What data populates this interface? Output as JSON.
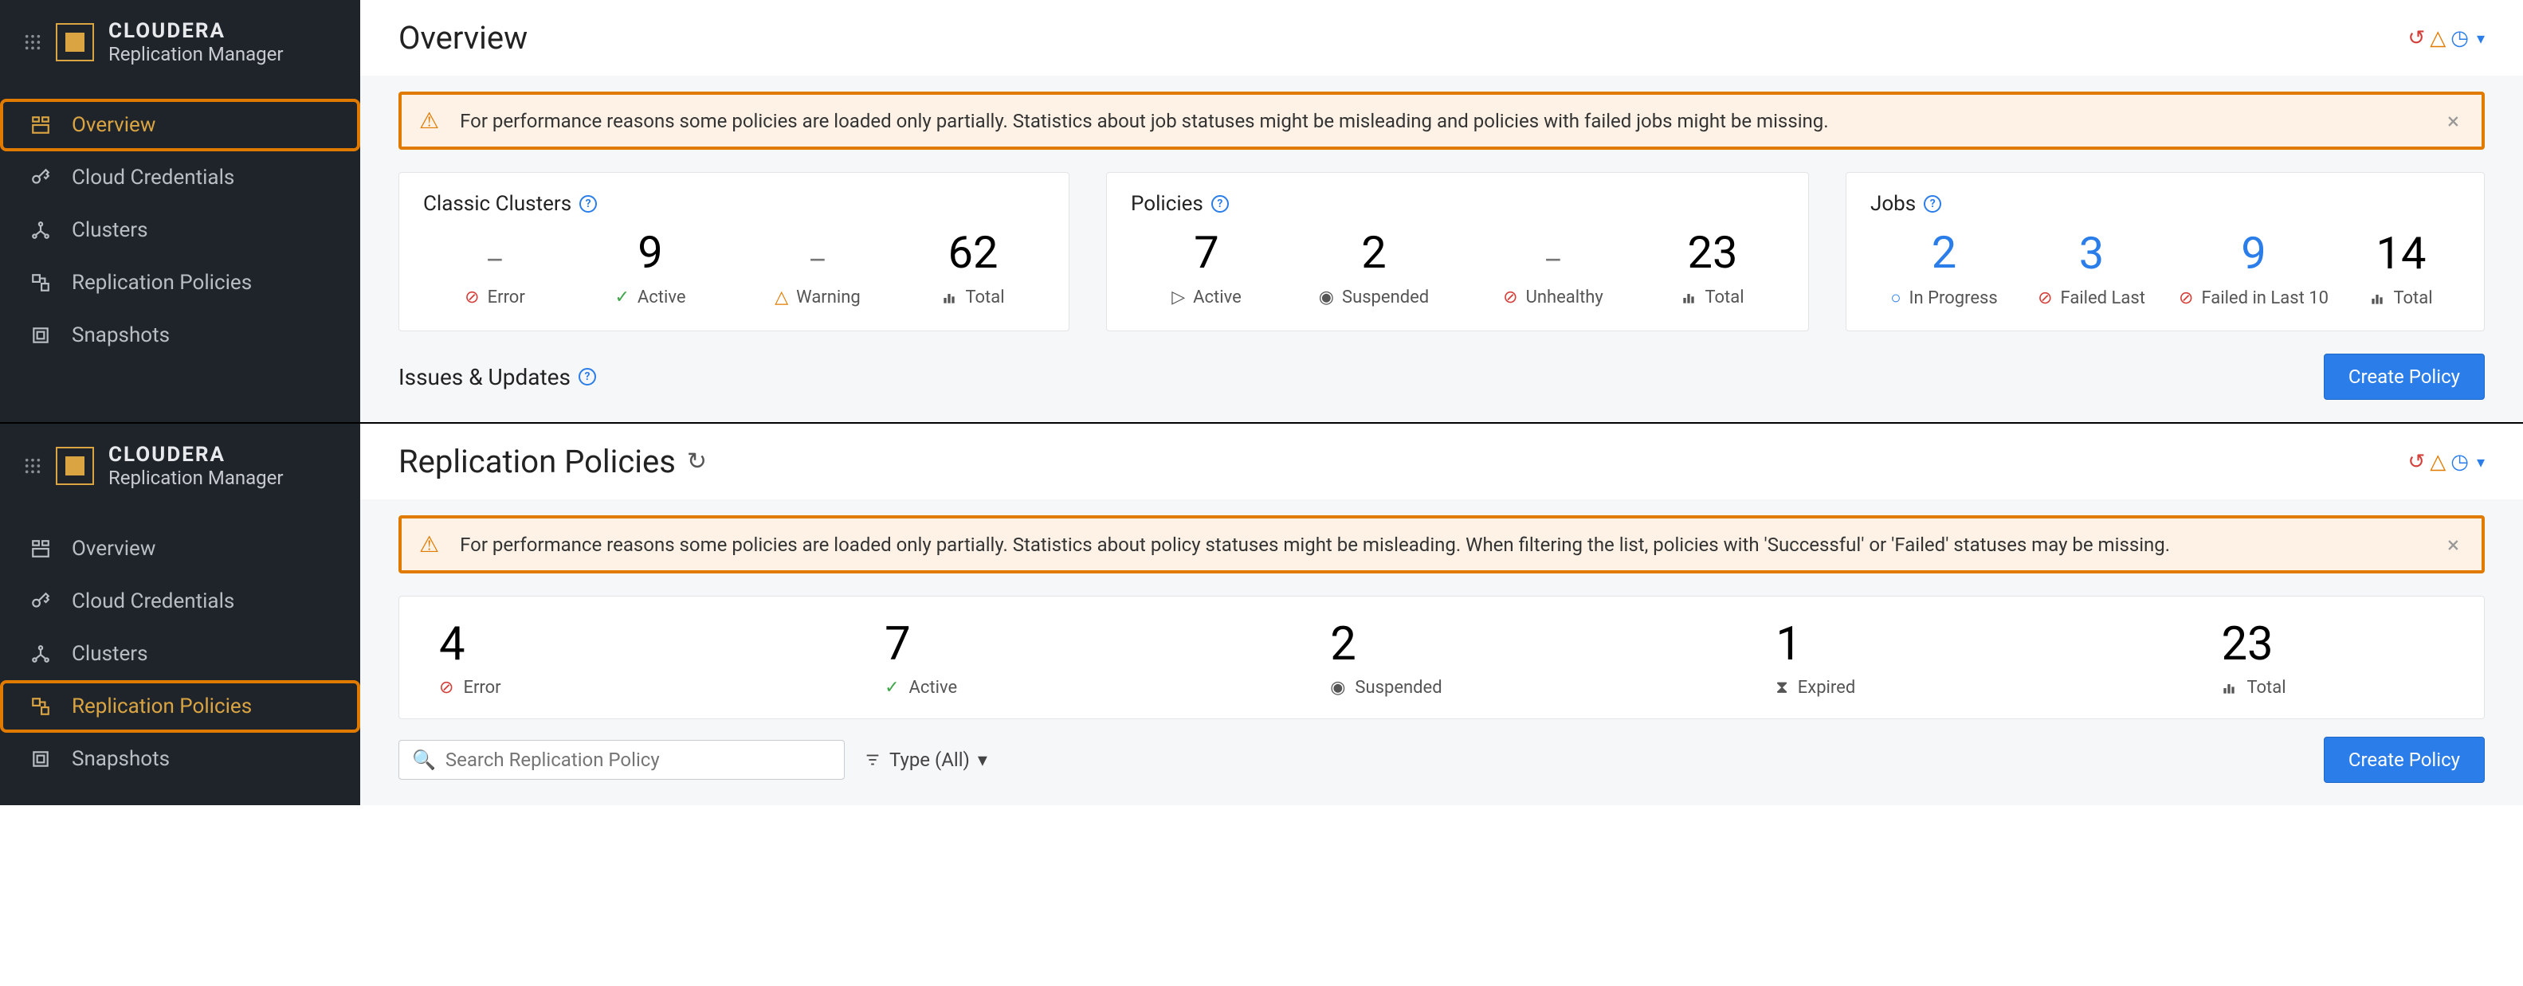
{
  "brand": {
    "name": "CLOUDERA",
    "product": "Replication Manager"
  },
  "nav": {
    "overview": "Overview",
    "cloud_credentials": "Cloud Credentials",
    "clusters": "Clusters",
    "replication_policies": "Replication Policies",
    "snapshots": "Snapshots"
  },
  "top": {
    "title": "Overview",
    "alert": "For performance reasons some policies are loaded only partially. Statistics about job statuses might be misleading and policies with failed jobs might be missing.",
    "cards": {
      "classic_clusters": {
        "title": "Classic Clusters",
        "error": {
          "value": "–",
          "label": "Error"
        },
        "active": {
          "value": "9",
          "label": "Active"
        },
        "warning": {
          "value": "–",
          "label": "Warning"
        },
        "total": {
          "value": "62",
          "label": "Total"
        }
      },
      "policies": {
        "title": "Policies",
        "active": {
          "value": "7",
          "label": "Active"
        },
        "suspended": {
          "value": "2",
          "label": "Suspended"
        },
        "unhealthy": {
          "value": "–",
          "label": "Unhealthy"
        },
        "total": {
          "value": "23",
          "label": "Total"
        }
      },
      "jobs": {
        "title": "Jobs",
        "in_progress": {
          "value": "2",
          "label": "In Progress"
        },
        "failed_last": {
          "value": "3",
          "label": "Failed Last"
        },
        "failed_last_10": {
          "value": "9",
          "label": "Failed in Last 10"
        },
        "total": {
          "value": "14",
          "label": "Total"
        }
      }
    },
    "issues_label": "Issues & Updates",
    "create_policy": "Create Policy"
  },
  "bottom": {
    "title": "Replication Policies",
    "alert": "For performance reasons some policies are loaded only partially. Statistics about policy statuses might be misleading. When filtering the list, policies with 'Successful' or 'Failed' statuses may be missing.",
    "summary": {
      "error": {
        "value": "4",
        "label": "Error"
      },
      "active": {
        "value": "7",
        "label": "Active"
      },
      "suspended": {
        "value": "2",
        "label": "Suspended"
      },
      "expired": {
        "value": "1",
        "label": "Expired"
      },
      "total": {
        "value": "23",
        "label": "Total"
      }
    },
    "search_placeholder": "Search Replication Policy",
    "type_filter": "Type (All)",
    "create_policy": "Create Policy"
  }
}
